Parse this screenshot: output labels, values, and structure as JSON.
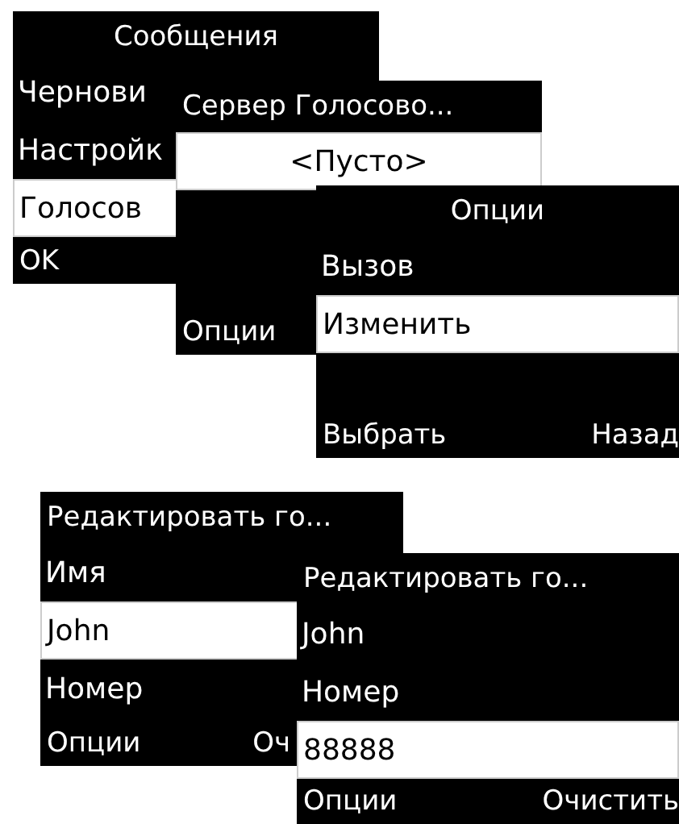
{
  "screens": [
    {
      "title": "Сообщения",
      "title_centered": true,
      "rows": [
        {
          "text": "Чернови",
          "kind": "item",
          "selected": false
        },
        {
          "text": "Настройк",
          "kind": "item",
          "selected": false
        },
        {
          "text": "Голосов",
          "kind": "item",
          "selected": true
        }
      ],
      "softkeys": {
        "left": "OK"
      }
    },
    {
      "title": "Сервер Голосово...",
      "title_centered": false,
      "rows": [
        {
          "text": "<Пусто>",
          "kind": "center",
          "selected": true
        }
      ],
      "softkeys": {
        "left": "Опции"
      }
    },
    {
      "title": "Опции",
      "title_centered": true,
      "rows": [
        {
          "text": "Вызов",
          "kind": "item",
          "selected": false
        },
        {
          "text": "Изменить",
          "kind": "item",
          "selected": true
        }
      ],
      "softkeys": {
        "left": "Выбрать",
        "right": "Назад"
      }
    },
    {
      "title": "Редактировать го...",
      "title_centered": false,
      "rows": [
        {
          "text": "Имя",
          "kind": "item",
          "selected": false
        },
        {
          "text": "John",
          "kind": "item",
          "selected": true
        },
        {
          "text": "Номер",
          "kind": "item",
          "selected": false
        }
      ],
      "softkeys": {
        "left": "Опции",
        "right": "Оч"
      }
    },
    {
      "title": "Редактировать го...",
      "title_centered": false,
      "rows": [
        {
          "text": "John",
          "kind": "item",
          "selected": false
        },
        {
          "text": "Номер",
          "kind": "item",
          "selected": false
        },
        {
          "text": "88888",
          "kind": "item",
          "selected": true
        }
      ],
      "softkeys": {
        "left": "Опции",
        "right": "Очистить"
      }
    }
  ]
}
